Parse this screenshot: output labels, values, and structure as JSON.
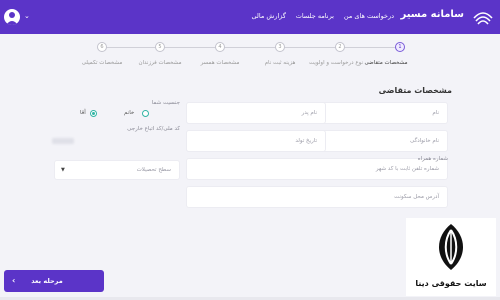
{
  "header": {
    "brand": "سامانه مسیر",
    "nav": [
      "درخواست های من",
      "برنامه جلسات",
      "گزارش مالی"
    ],
    "caret": "⌄",
    "colors": {
      "accent": "#5b34c8",
      "radio": "#32b5a5"
    }
  },
  "stepper": {
    "steps": [
      {
        "label": "مشخصات متقاضی",
        "number": "1",
        "active": true
      },
      {
        "label": "نوع درخواست و اولویت",
        "number": "2",
        "active": false
      },
      {
        "label": "هزینه ثبت نام",
        "number": "3",
        "active": false
      },
      {
        "label": "مشخصات همسر",
        "number": "4",
        "active": false
      },
      {
        "label": "مشخصات فرزندان",
        "number": "5",
        "active": false
      },
      {
        "label": "مشخصات تکمیلی",
        "number": "6",
        "active": false
      }
    ]
  },
  "form": {
    "section_title": "مشخصات متقاضی",
    "first_name": "نام",
    "last_name": "نام خانوادگی",
    "father_name": "نام پدر",
    "birth_date": "تاریخ تولد",
    "phone_label": "شماره همراه",
    "landline": "شماره تلفن ثابت با کد شهر",
    "address": "آدرس محل سکونت",
    "gender_label": "جنسیت شما",
    "gender_male": "آقا",
    "gender_female": "خانم",
    "gender_selected": "male",
    "foreign_id": "کد ملی/کد اتباع خارجی",
    "education": "سطح تحصیلات",
    "select_caret": "▼"
  },
  "footer": {
    "next_label": "مرحله بعد",
    "next_chevron": "‹"
  },
  "watermark": {
    "text": "سایت حقوقی دینا"
  }
}
